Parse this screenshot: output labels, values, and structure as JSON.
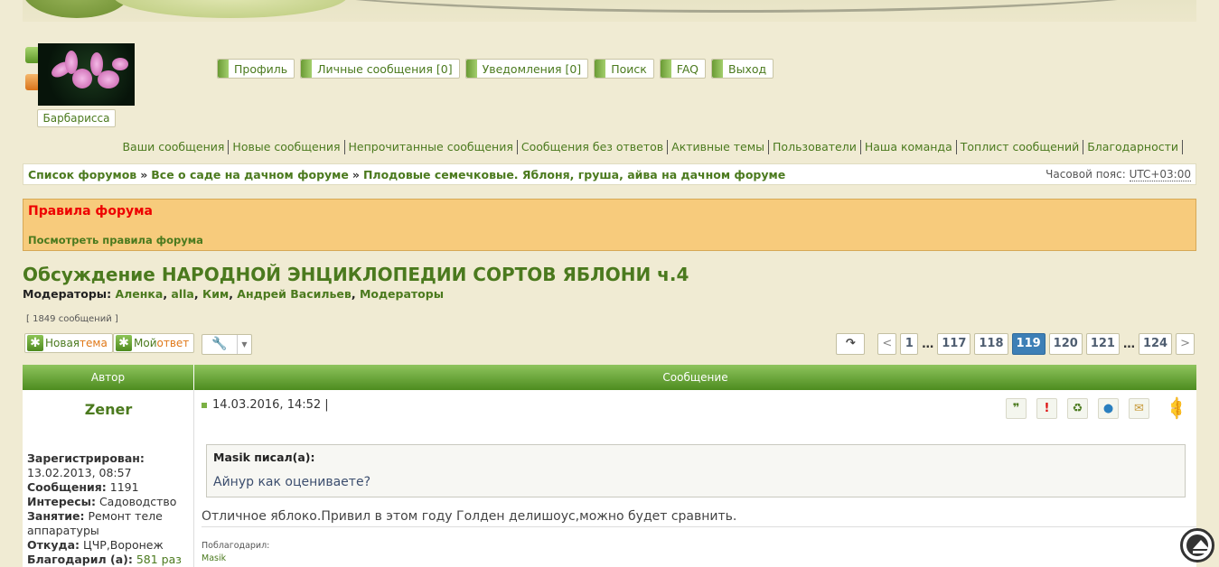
{
  "topnav": [
    {
      "label": "Профиль"
    },
    {
      "label": "Личные сообщения [0]"
    },
    {
      "label": "Уведомления [0]"
    },
    {
      "label": "Поиск"
    },
    {
      "label": "FAQ"
    },
    {
      "label": "Выход"
    }
  ],
  "user": {
    "name": "Барбарисса"
  },
  "subnav": [
    "Ваши сообщения",
    "Новые сообщения",
    "Непрочитанные сообщения",
    "Сообщения без ответов",
    "Активные темы",
    "Пользователи",
    "Наша команда",
    "Топлист сообщений",
    "Благодарности"
  ],
  "breadcrumb": {
    "items": [
      "Список форумов",
      "Все о саде на дачном форуме",
      "Плодовые семечковые. Яблоня, груша, айва на дачном форуме"
    ],
    "sep": "»",
    "tz_label": "Часовой пояс:",
    "tz_value": "UTC+03:00"
  },
  "rules": {
    "title": "Правила форума",
    "link": "Посмотреть правила форума"
  },
  "topic": {
    "title": "Обсуждение НАРОДНОЙ ЭНЦИКЛОПЕДИИ СОРТОВ ЯБЛОНИ ч.4",
    "mods_label": "Модераторы:",
    "mods": [
      "Аленка",
      "alla",
      "Ким",
      "Андрей Васильев",
      "Модераторы"
    ],
    "count": "[ 1849 сообщений ]"
  },
  "actions": {
    "new_topic_a": "Новая ",
    "new_topic_b": "тема",
    "reply_a": "Мой ",
    "reply_b": "ответ",
    "tools_icon": "wrench-icon"
  },
  "pager": {
    "jump": "↷",
    "prev": "<",
    "next": ">",
    "pages": [
      "1",
      "117",
      "118",
      "119",
      "120",
      "121",
      "124"
    ],
    "current": "119",
    "dots": "…"
  },
  "table": {
    "col_author": "Автор",
    "col_message": "Сообщение"
  },
  "post": {
    "author": "Zener",
    "profile": [
      {
        "k": "Зарегистрирован:",
        "v": " 13.02.2013, 08:57"
      },
      {
        "k": "Сообщения:",
        "v": " 1191"
      },
      {
        "k": "Интересы:",
        "v": " Садоводство"
      },
      {
        "k": "Занятие:",
        "v": " Ремонт теле аппаратуры"
      },
      {
        "k": "Откуда:",
        "v": " ЦЧР,Воронеж"
      },
      {
        "k": "Благодарил (а):",
        "v": " 581 раз"
      }
    ],
    "date": "14.03.2016, 14:52 |",
    "quote_header": "Masik писал(а):",
    "quote_text": "Айнур как оцениваете?",
    "text": "Отличное яблоко.Привил в этом году Голден делишоус,можно будет сравнить.",
    "thanks_label": "Поблагодарил:",
    "thanks_user": "Masik",
    "icons": [
      {
        "name": "quote-icon",
        "glyph": "99",
        "color": "#4b7a1e"
      },
      {
        "name": "report-icon",
        "glyph": "!",
        "color": "#d11"
      },
      {
        "name": "thanks-icon",
        "glyph": "♻",
        "color": "#4b7a1e"
      },
      {
        "name": "pm-icon",
        "glyph": "●",
        "color": "#2a7fbf"
      },
      {
        "name": "email-icon",
        "glyph": "✉",
        "color": "#c79a3a"
      }
    ]
  }
}
